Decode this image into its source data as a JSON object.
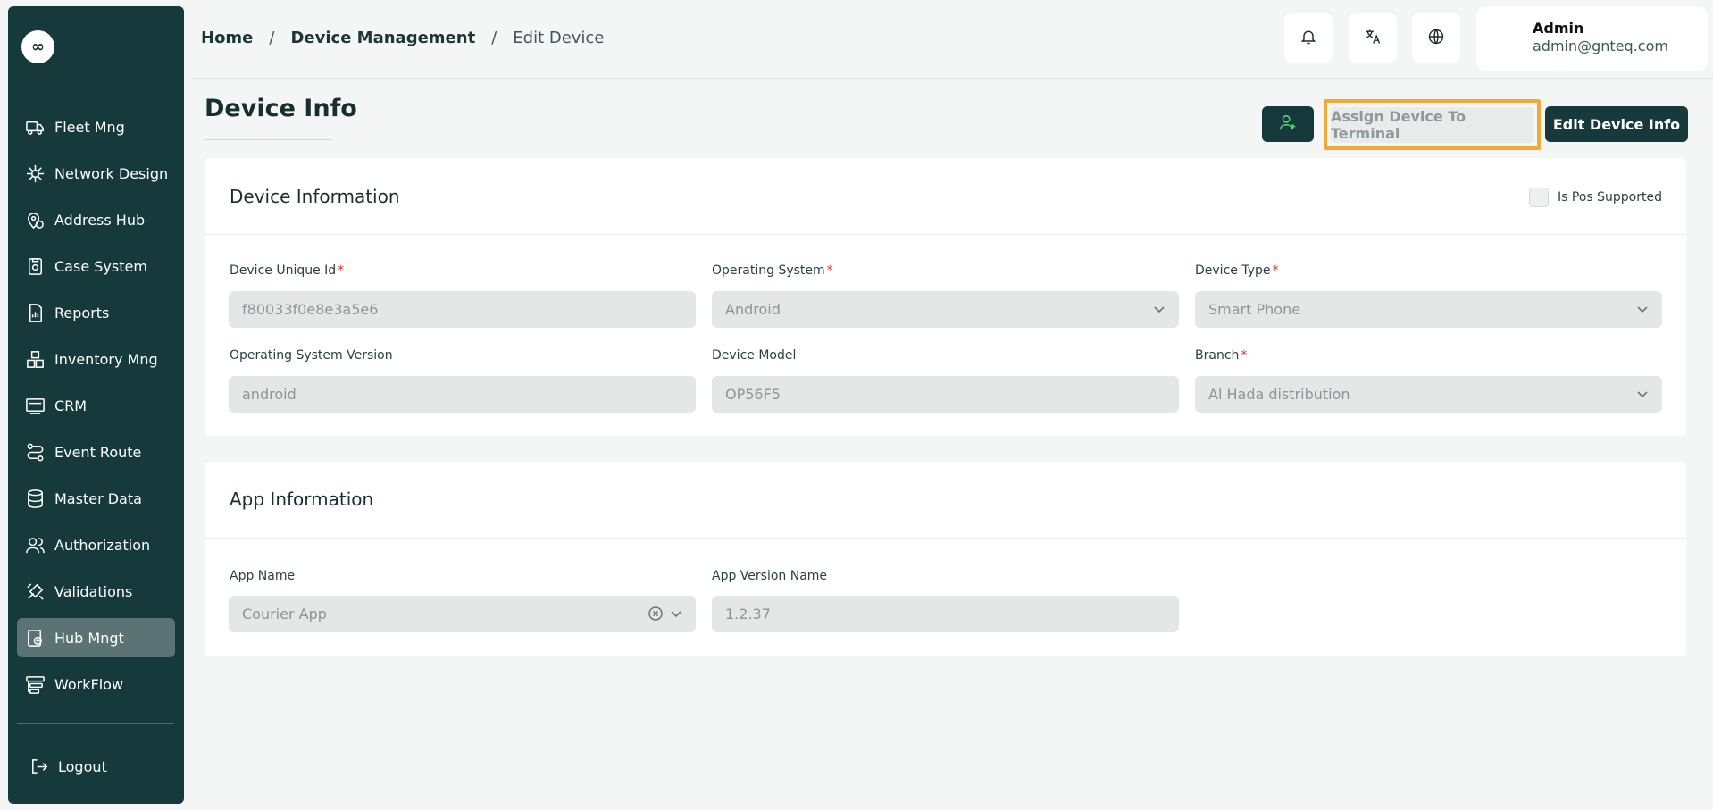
{
  "sidebar": {
    "logo_glyph": "∞",
    "items": [
      {
        "label": "Fleet Mng",
        "icon": "truck-icon"
      },
      {
        "label": "Network Design",
        "icon": "network-icon"
      },
      {
        "label": "Address Hub",
        "icon": "map-pin-icon"
      },
      {
        "label": "Case System",
        "icon": "case-icon"
      },
      {
        "label": "Reports",
        "icon": "report-icon"
      },
      {
        "label": "Inventory Mng",
        "icon": "inventory-icon"
      },
      {
        "label": "CRM",
        "icon": "crm-icon"
      },
      {
        "label": "Event Route",
        "icon": "route-icon"
      },
      {
        "label": "Master Data",
        "icon": "database-icon"
      },
      {
        "label": "Authorization",
        "icon": "users-icon"
      },
      {
        "label": "Validations",
        "icon": "validation-icon"
      },
      {
        "label": "Hub Mngt",
        "icon": "hub-icon",
        "active": true
      },
      {
        "label": "WorkFlow",
        "icon": "workflow-icon"
      }
    ],
    "logout_label": "Logout"
  },
  "header": {
    "breadcrumb": [
      "Home",
      "Device Management",
      "Edit Device"
    ],
    "separator": "/",
    "user_name": "Admin",
    "user_email": "admin@gnteq.com"
  },
  "page": {
    "title": "Device Info",
    "assign_label": "Assign Device To Terminal",
    "edit_label": "Edit Device Info"
  },
  "device_info": {
    "title": "Device Information",
    "pos_label": "Is Pos Supported",
    "device_unique_id_label": "Device Unique Id",
    "device_unique_id_value": "f80033f0e8e3a5e6",
    "os_label": "Operating System",
    "os_value": "Android",
    "device_type_label": "Device Type",
    "device_type_value": "Smart Phone",
    "os_version_label": "Operating System Version",
    "os_version_value": "android",
    "device_model_label": "Device Model",
    "device_model_value": "OP56F5",
    "branch_label": "Branch",
    "branch_value": "Al Hada distribution",
    "required_mark": "*"
  },
  "app_info": {
    "title": "App Information",
    "app_name_label": "App Name",
    "app_name_value": "Courier App",
    "app_version_label": "App Version Name",
    "app_version_value": "1.2.37"
  },
  "colors": {
    "sidebar_bg": "#163a3c",
    "highlight": "#f1aa3a",
    "required": "#e0322f"
  }
}
